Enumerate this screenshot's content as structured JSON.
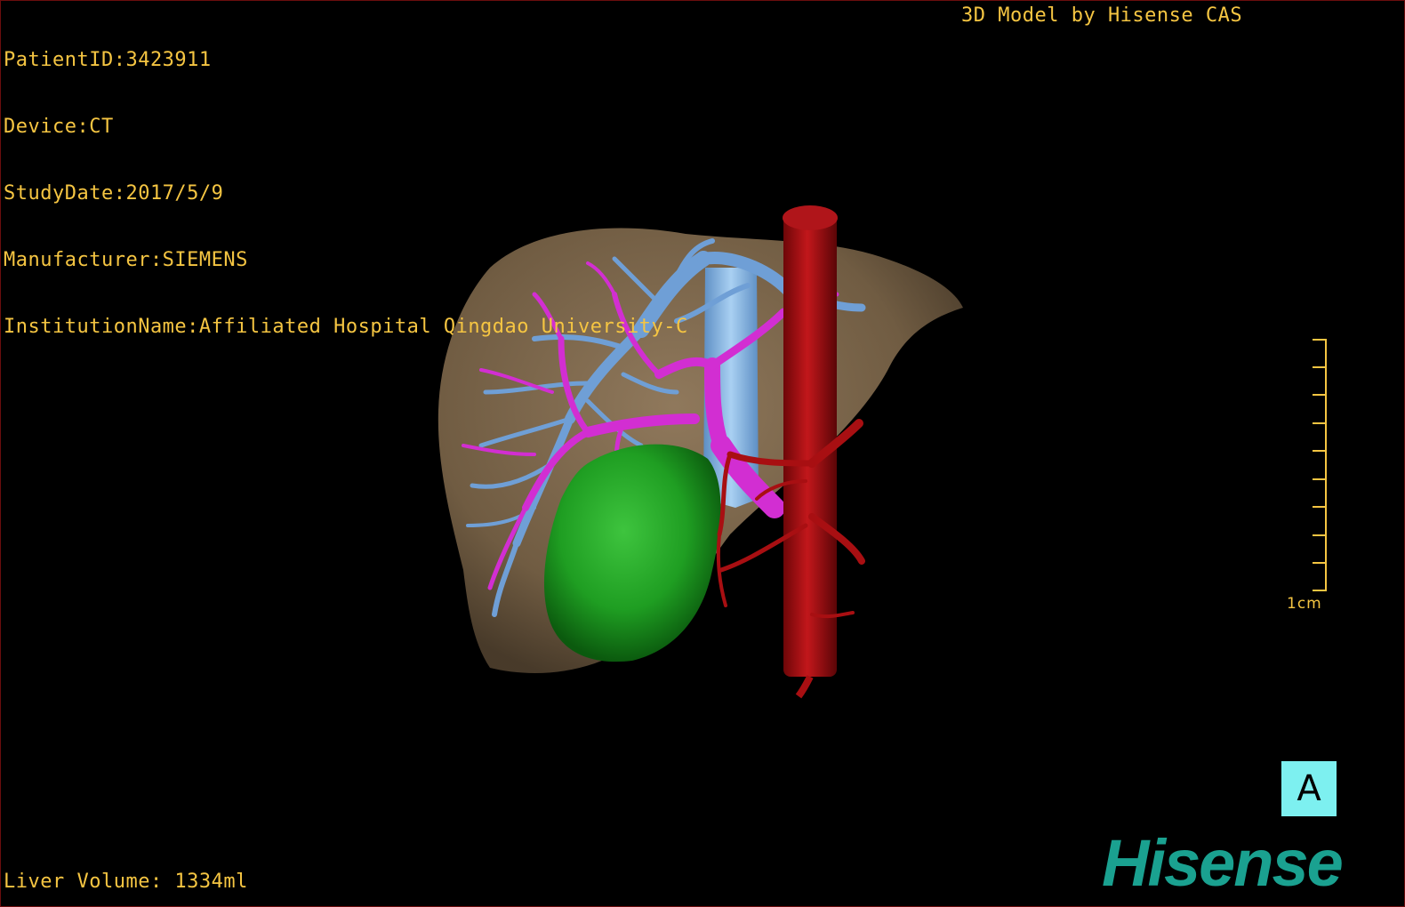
{
  "overlay": {
    "patient_id": "PatientID:3423911",
    "device": "Device:CT",
    "study_date": "StudyDate:2017/5/9",
    "manufacturer": "Manufacturer:SIEMENS",
    "institution": "InstitutionName:Affiliated Hospital Qingdao University-C",
    "title": "3D Model by Hisense CAS",
    "liver_volume": "Liver Volume: 1334ml"
  },
  "scale": {
    "label": "1cm"
  },
  "orientation": {
    "label": "A"
  },
  "logo": {
    "text": "Hisense"
  },
  "colors": {
    "overlay_text": "#f5c542",
    "liver": "#8a7355",
    "portal_vein": "#d22ed2",
    "hepatic_vein": "#6f9fd6",
    "aorta": "#a80f12",
    "tumor": "#1f9e22",
    "orientation_box": "#7df0f0",
    "logo": "#1aa190"
  }
}
